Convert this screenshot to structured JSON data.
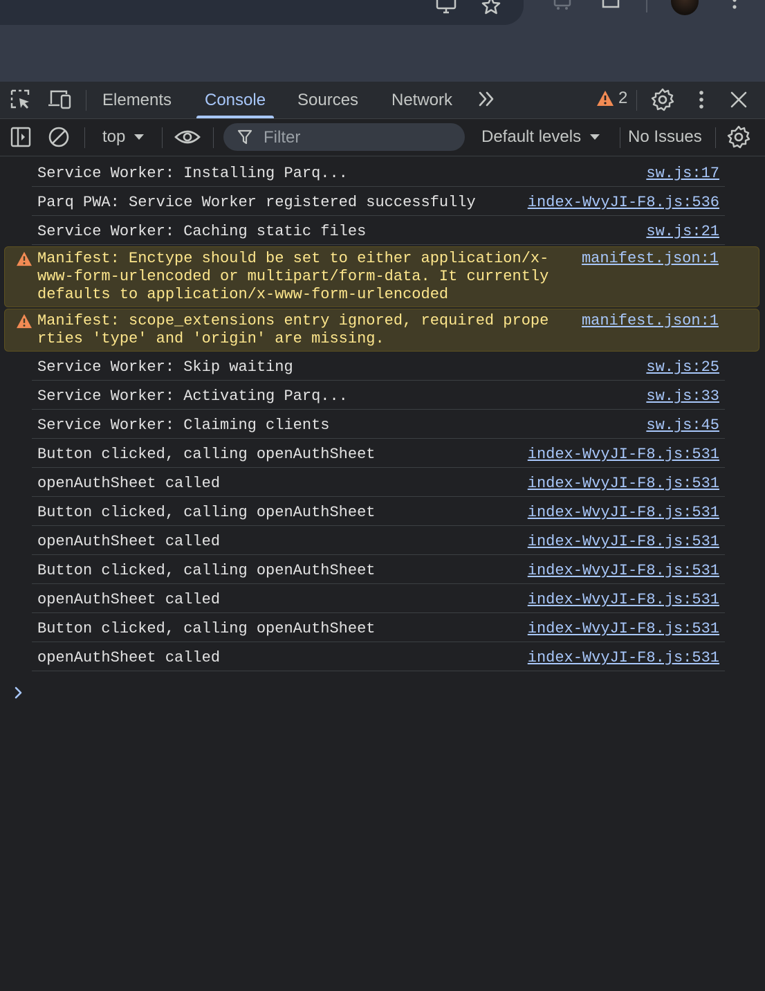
{
  "devtools": {
    "tabs": [
      {
        "label": "Elements"
      },
      {
        "label": "Console"
      },
      {
        "label": "Sources"
      },
      {
        "label": "Network"
      }
    ],
    "warning_count": "2",
    "accent_color": "#a8c7fa"
  },
  "toolbar": {
    "context": "top",
    "filter_placeholder": "Filter",
    "levels": "Default levels",
    "issues": "No Issues"
  },
  "console": {
    "messages": [
      {
        "level": "log",
        "text": "Service Worker: Installing Parq...",
        "source": "sw.js:17"
      },
      {
        "level": "log",
        "text": "Parq PWA: Service Worker registered successfully",
        "source": "index-WvyJI-F8.js:536"
      },
      {
        "level": "log",
        "text": "Service Worker: Caching static files",
        "source": "sw.js:21"
      },
      {
        "level": "warn",
        "text": "Manifest: Enctype should be set to either application/x-www-form-urlencoded or multipart/form-data. It currently defaults to application/x-www-form-urlencoded",
        "source": "manifest.json:1"
      },
      {
        "level": "warn",
        "text": "Manifest: scope_extensions entry ignored, required properties 'type' and 'origin' are missing.",
        "source": "manifest.json:1"
      },
      {
        "level": "log",
        "text": "Service Worker: Skip waiting",
        "source": "sw.js:25"
      },
      {
        "level": "log",
        "text": "Service Worker: Activating Parq...",
        "source": "sw.js:33"
      },
      {
        "level": "log",
        "text": "Service Worker: Claiming clients",
        "source": "sw.js:45"
      },
      {
        "level": "log",
        "text": "Button clicked, calling openAuthSheet",
        "source": "index-WvyJI-F8.js:531"
      },
      {
        "level": "log",
        "text": "openAuthSheet called",
        "source": "index-WvyJI-F8.js:531"
      },
      {
        "level": "log",
        "text": "Button clicked, calling openAuthSheet",
        "source": "index-WvyJI-F8.js:531"
      },
      {
        "level": "log",
        "text": "openAuthSheet called",
        "source": "index-WvyJI-F8.js:531"
      },
      {
        "level": "log",
        "text": "Button clicked, calling openAuthSheet",
        "source": "index-WvyJI-F8.js:531"
      },
      {
        "level": "log",
        "text": "openAuthSheet called",
        "source": "index-WvyJI-F8.js:531"
      },
      {
        "level": "log",
        "text": "Button clicked, calling openAuthSheet",
        "source": "index-WvyJI-F8.js:531"
      },
      {
        "level": "log",
        "text": "openAuthSheet called",
        "source": "index-WvyJI-F8.js:531"
      }
    ],
    "prompt_symbol": "›"
  }
}
